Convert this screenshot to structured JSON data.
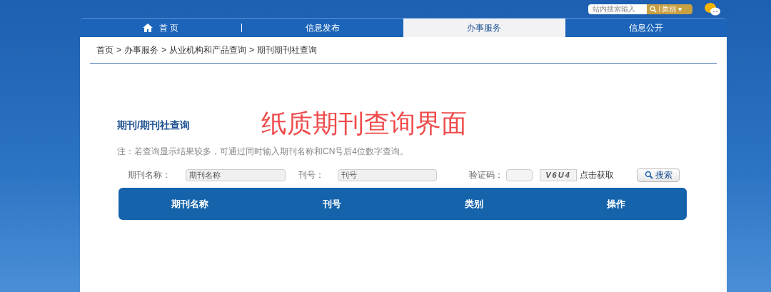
{
  "top_search": {
    "placeholder": "站内搜索输入",
    "category": "类别",
    "caret": "▾"
  },
  "nav": [
    {
      "label": "首 页",
      "selected": false,
      "kind": "home"
    },
    {
      "label": "信息发布",
      "selected": false,
      "kind": "plain"
    },
    {
      "label": "办事服务",
      "selected": true,
      "kind": "plain"
    },
    {
      "label": "信息公开",
      "selected": false,
      "kind": "plain"
    }
  ],
  "breadcrumb": [
    "首页",
    "办事服务",
    "从业机构和产品查询",
    "期刊期刊社查询"
  ],
  "breadcrumb_separator": ">",
  "title": "期刊/期刊社查询",
  "annotation": "纸质期刊查询界面",
  "note": "注：若查询显示结果较多，可通过同时输入期刊名称和CN号后4位数字查询。",
  "form": {
    "name_label": "期刊名称：",
    "name_placeholder": "期刊名称",
    "issn_label": "刊号：",
    "issn_placeholder": "刊号",
    "captcha_label": "验证码：",
    "captcha_code": "V6U4",
    "captcha_link": "点击获取",
    "search_button": "搜索"
  },
  "table": {
    "columns": [
      "期刊名称",
      "刊号",
      "类别",
      "操作"
    ]
  }
}
